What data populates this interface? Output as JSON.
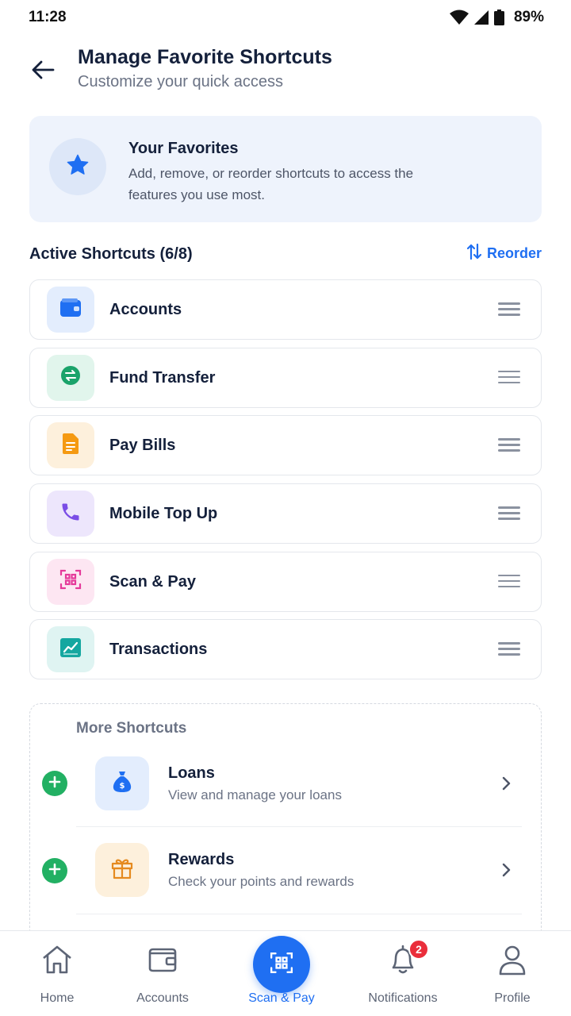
{
  "status_bar": {
    "time": "11:28",
    "battery": "89%"
  },
  "header": {
    "title": "Manage Favorite Shortcuts",
    "subtitle": "Customize your quick access"
  },
  "info_card": {
    "title": "Your Favorites",
    "description": "Add, remove, or reorder shortcuts to access the features you use most."
  },
  "active_section": {
    "title": "Active Shortcuts (6/8)",
    "reorder_label": "Reorder"
  },
  "active_shortcuts": [
    {
      "label": "Accounts",
      "icon": "wallet-icon",
      "color": "#1f6ff2",
      "bg": "#e3edfd"
    },
    {
      "label": "Fund Transfer",
      "icon": "transfer-icon",
      "color": "#1aa36a",
      "bg": "#e1f5ec"
    },
    {
      "label": "Pay Bills",
      "icon": "bill-icon",
      "color": "#f59a12",
      "bg": "#fdf0dc"
    },
    {
      "label": "Mobile Top Up",
      "icon": "phone-icon",
      "color": "#7a4de6",
      "bg": "#ede6fc"
    },
    {
      "label": "Scan & Pay",
      "icon": "qr-scan-icon",
      "color": "#e5399a",
      "bg": "#fde6f2"
    },
    {
      "label": "Transactions",
      "icon": "chart-icon",
      "color": "#15a7a0",
      "bg": "#dff4f2"
    }
  ],
  "more_section": {
    "title": "More Shortcuts",
    "items": [
      {
        "label": "Loans",
        "description": "View and manage your loans",
        "icon": "money-bag-icon",
        "color": "#1f6ff2",
        "bg": "#e3edfd"
      },
      {
        "label": "Rewards",
        "description": "Check your points and rewards",
        "icon": "gift-icon",
        "color": "#e58a1f",
        "bg": "#fdf0dc"
      }
    ]
  },
  "bottom_nav": {
    "items": [
      {
        "label": "Home",
        "icon": "home-icon"
      },
      {
        "label": "Accounts",
        "icon": "wallet-icon"
      },
      {
        "label": "Scan & Pay",
        "icon": "qr-scan-icon",
        "active": true
      },
      {
        "label": "Notifications",
        "icon": "bell-icon",
        "badge": "2"
      },
      {
        "label": "Profile",
        "icon": "user-icon"
      }
    ],
    "accent": "#1f6ff2"
  }
}
